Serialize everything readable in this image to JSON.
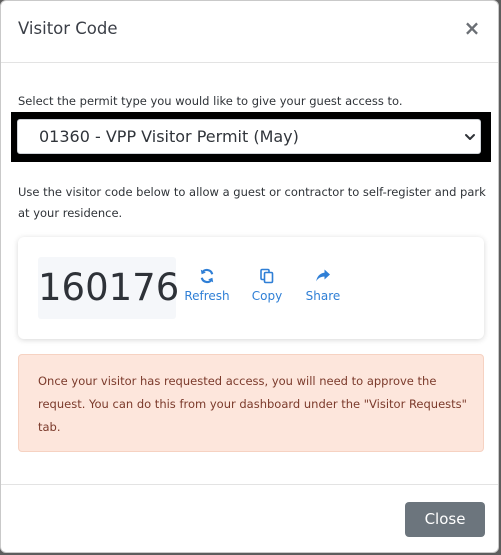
{
  "modal": {
    "title": "Visitor Code",
    "close_icon": "close-icon"
  },
  "permit": {
    "label": "Select the permit type you would like to give your guest access to.",
    "selected": "01360 - VPP Visitor Permit (May)"
  },
  "description": "Use the visitor code below to allow a guest or contractor to self-register and park at your residence.",
  "code": {
    "value": "160176",
    "actions": [
      {
        "label": "Refresh",
        "icon": "refresh-icon"
      },
      {
        "label": "Copy",
        "icon": "copy-icon"
      },
      {
        "label": "Share",
        "icon": "share-icon"
      }
    ]
  },
  "notice": {
    "text": "Once your visitor has requested access, you will need to approve the request. You can do this from your dashboard under the \"Visitor Requests\" tab."
  },
  "footer": {
    "close_label": "Close"
  },
  "colors": {
    "accent": "#2f7fd6",
    "notice_bg": "#fde6dc",
    "notice_text": "#7b3a2b",
    "close_button": "#6c757d"
  }
}
